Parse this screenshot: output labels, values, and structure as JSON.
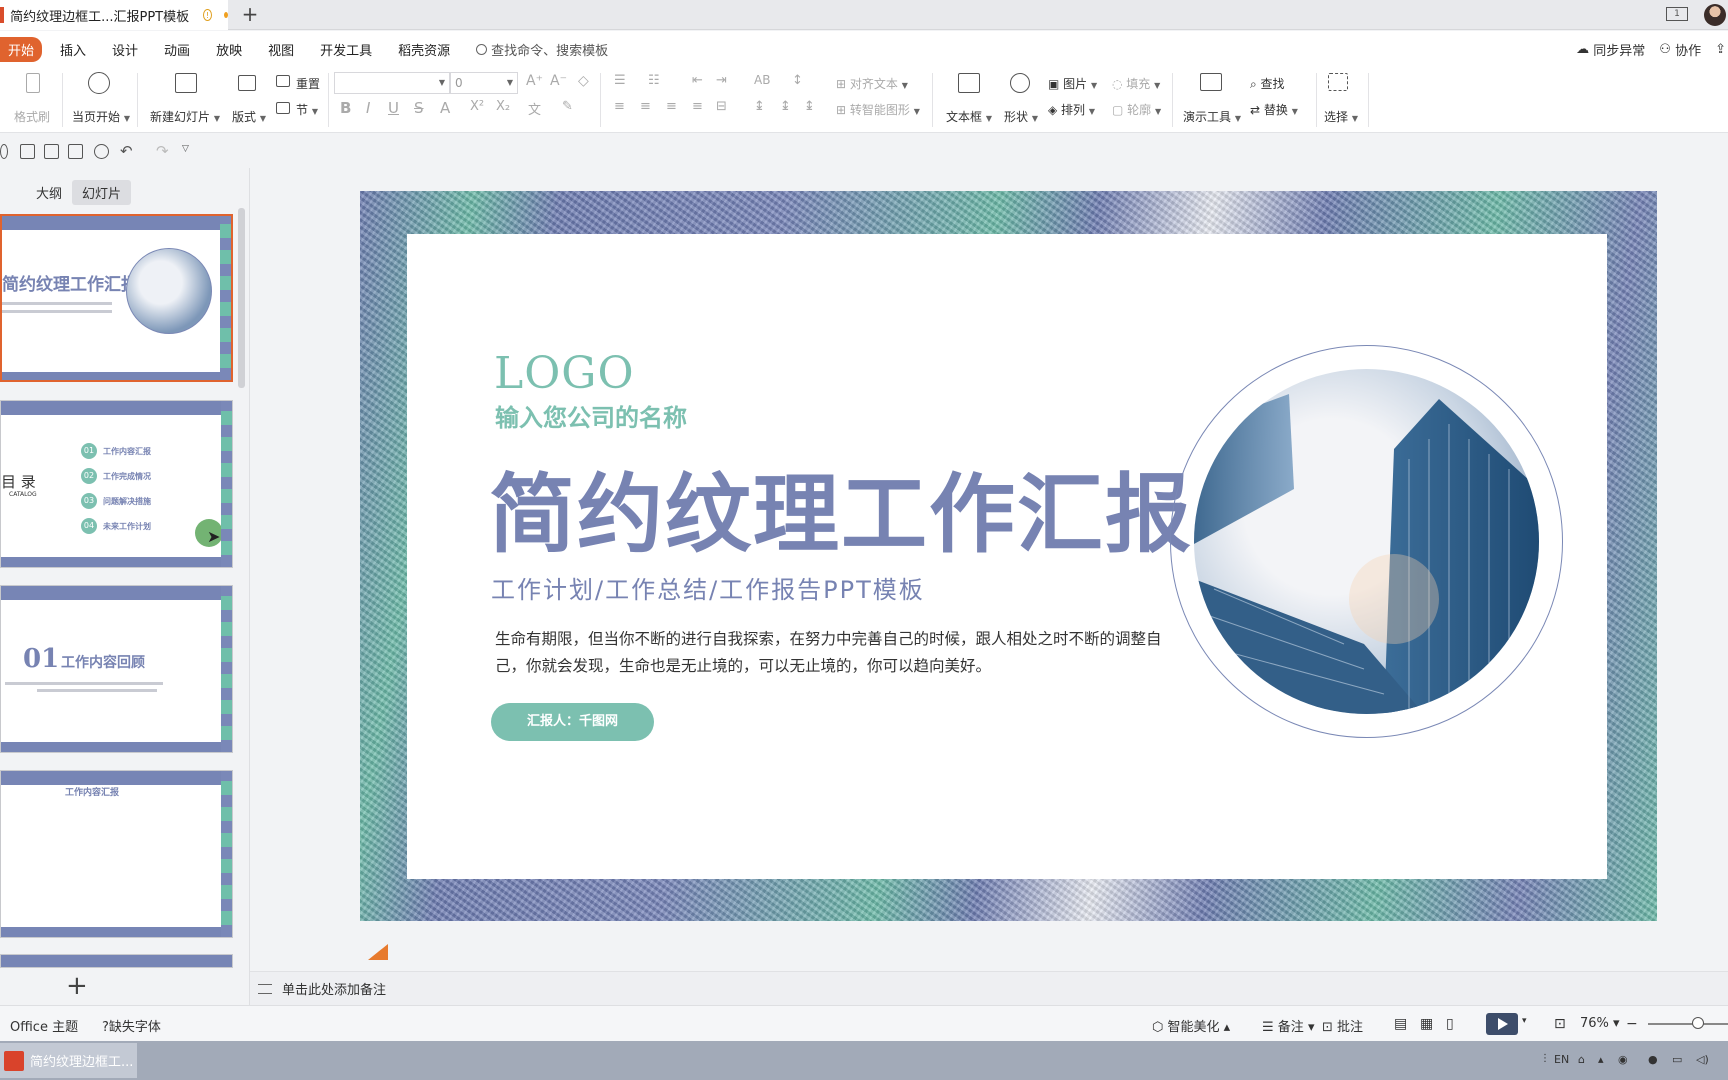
{
  "titlebar": {
    "doc_title": "简约纹理边框工...汇报PPT模板",
    "new_tab": "+",
    "window_icon": "1"
  },
  "menubar": {
    "items": [
      "开始",
      "插入",
      "设计",
      "动画",
      "放映",
      "视图",
      "开发工具",
      "稻壳资源"
    ],
    "search_placeholder": "查找命令、搜索模板",
    "right": {
      "sync": "同步异常",
      "collab": "协作"
    }
  },
  "ribbon": {
    "format_painter": "格式刷",
    "from_current": "当页开始",
    "new_slide": "新建幻灯片",
    "layout": "版式",
    "section": "节",
    "reset": "重置",
    "font_size": "0",
    "align_text": "对齐文本",
    "smart_shape": "转智能图形",
    "textbox": "文本框",
    "shape": "形状",
    "picture": "图片",
    "arrange": "排列",
    "fill": "填充",
    "outline": "轮廓",
    "present_tools": "演示工具",
    "find": "查找",
    "replace": "替换",
    "select": "选择"
  },
  "leftpane": {
    "tabs": [
      "大纲",
      "幻灯片"
    ],
    "thumb1_title": "简约纹理工作汇报",
    "thumb2_title": "目 录",
    "thumb2_sub": "CATALOG",
    "thumb2_items": [
      {
        "num": "01",
        "label": "工作内容汇报"
      },
      {
        "num": "02",
        "label": "工作完成情况"
      },
      {
        "num": "03",
        "label": "问题解决措施"
      },
      {
        "num": "04",
        "label": "未来工作计划"
      }
    ],
    "thumb3_num": "01",
    "thumb3_title": "工作内容回顾",
    "thumb4_title": "工作内容汇报",
    "add_slide": "+"
  },
  "slide": {
    "logo": "LOGO",
    "company": "输入您公司的名称",
    "title": "简约纹理工作汇报",
    "subtitle": "工作计划/工作总结/工作报告PPT模板",
    "body": "生命有期限，但当你不断的进行自我探索，在努力中完善自己的时候，跟人相处之时不断的调整自己，你就会发现，生命也是无止境的，可以无止境的，你可以趋向美好。",
    "reporter": "汇报人：千图网"
  },
  "notes": {
    "placeholder": "单击此处添加备注"
  },
  "statusbar": {
    "theme": "Office 主题",
    "missing_font": "缺失字体",
    "beautify": "智能美化",
    "notes": "备注",
    "comments": "批注",
    "zoom": "76%"
  },
  "taskbar": {
    "task_title": "简约纹理边框工...",
    "lang": "EN"
  },
  "colors": {
    "accent_orange": "#e0632e",
    "slide_blue": "#7783b2",
    "slide_teal": "#7cc0b0"
  }
}
